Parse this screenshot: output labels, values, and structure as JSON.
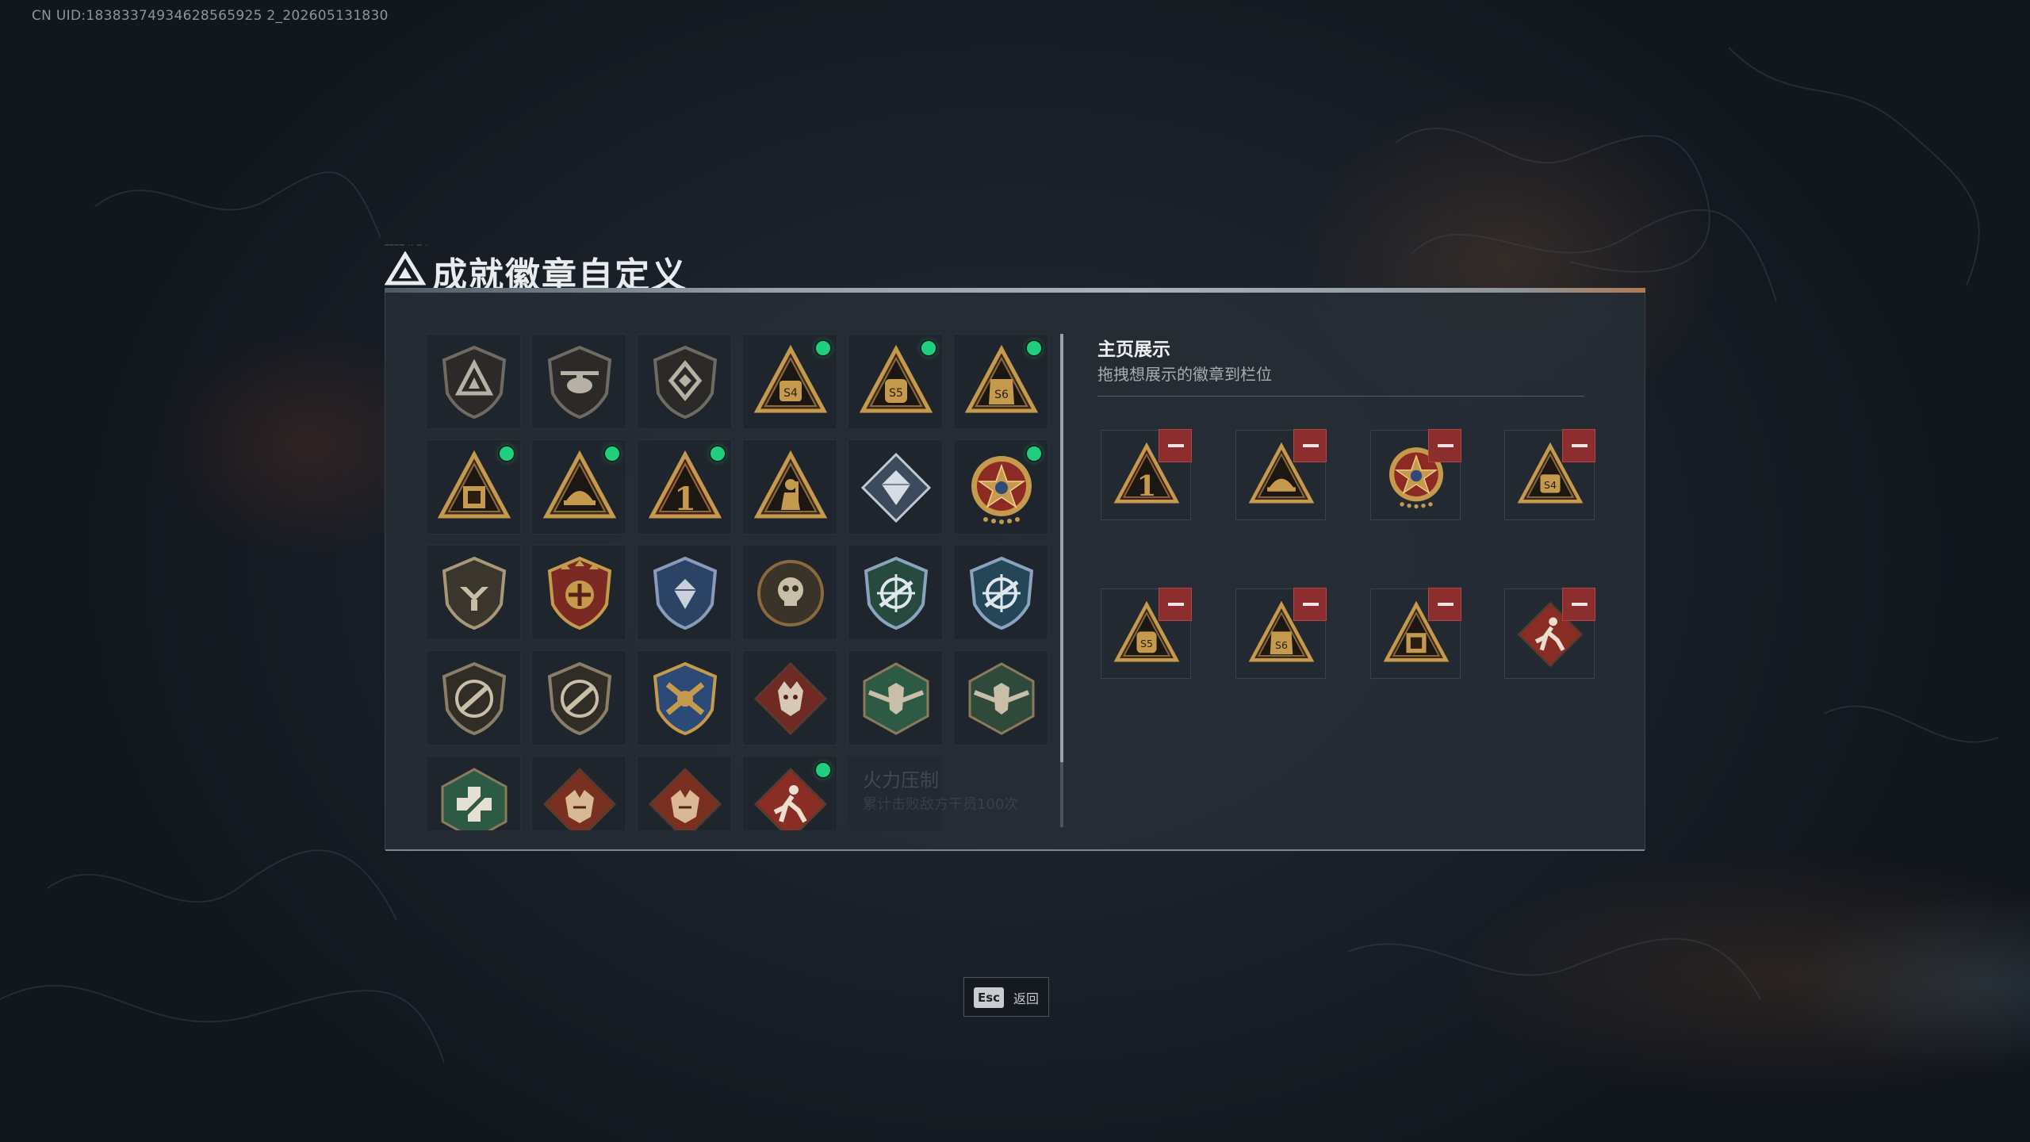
{
  "uid": "CN UID:18383374934628565925 2_202605131830",
  "title": "成就徽章自定义",
  "colors": {
    "accent_new": "#1fcf7e",
    "remove": "#8c2e2e",
    "gold": "#c59a4c",
    "bronze": "#8a6a3c",
    "red_badge": "#6e2a23",
    "green_badge": "#2d5a44",
    "blue_badge": "#2b4466"
  },
  "badge_grid": [
    {
      "icon": "triangle-shield-icon",
      "new": false
    },
    {
      "icon": "helicopter-shield-icon",
      "new": false
    },
    {
      "icon": "diamond-shield-icon",
      "new": false
    },
    {
      "icon": "s4-backpack-triangle-icon",
      "new": true
    },
    {
      "icon": "s5-backpack-triangle-icon",
      "new": true
    },
    {
      "icon": "s6-vest-triangle-icon",
      "new": true
    },
    {
      "icon": "s3-case-triangle-icon",
      "new": true
    },
    {
      "icon": "helmet-triangle-icon",
      "new": true
    },
    {
      "icon": "rank-1-triangle-icon",
      "new": true
    },
    {
      "icon": "soldier-triangle-icon",
      "new": false
    },
    {
      "icon": "crystal-diamond-icon",
      "new": false
    },
    {
      "icon": "star-medal-icon",
      "new": true
    },
    {
      "icon": "eagle-shield-icon",
      "new": false
    },
    {
      "icon": "winged-crest-icon",
      "new": false
    },
    {
      "icon": "blue-crest-icon",
      "new": false
    },
    {
      "icon": "skull-emblem-icon",
      "new": false
    },
    {
      "icon": "sniper-shield-icon",
      "new": false
    },
    {
      "icon": "sniper-shield-blue-icon",
      "new": false
    },
    {
      "icon": "rifle-shield-icon",
      "new": false
    },
    {
      "icon": "rifle-shield-alt-icon",
      "new": false
    },
    {
      "icon": "crossed-rifles-crest-icon",
      "new": false
    },
    {
      "icon": "wolf-diamond-icon",
      "new": false
    },
    {
      "icon": "winged-wolf-hex-icon",
      "new": false
    },
    {
      "icon": "winged-wolf-hex-alt-icon",
      "new": false
    },
    {
      "icon": "medic-hex-icon",
      "new": false
    },
    {
      "icon": "dragon-diamond-icon",
      "new": false
    },
    {
      "icon": "dragon-diamond-alt-icon",
      "new": false
    },
    {
      "icon": "runner-diamond-icon",
      "new": true
    }
  ],
  "faded_card": {
    "title": "火力压制",
    "subtitle": "累计击败敌方干员100次"
  },
  "showcase": {
    "title": "主页展示",
    "subtitle": "拖拽想展示的徽章到栏位",
    "slots": [
      {
        "icon": "rank-1-triangle-icon"
      },
      {
        "icon": "helmet-triangle-icon"
      },
      {
        "icon": "star-medal-icon"
      },
      {
        "icon": "s4-backpack-triangle-icon"
      },
      {
        "icon": "s5-backpack-triangle-icon"
      },
      {
        "icon": "s6-vest-triangle-icon"
      },
      {
        "icon": "s3-case-triangle-icon"
      },
      {
        "icon": "runner-diamond-icon"
      }
    ]
  },
  "esc": {
    "key": "Esc",
    "label": "返回"
  }
}
